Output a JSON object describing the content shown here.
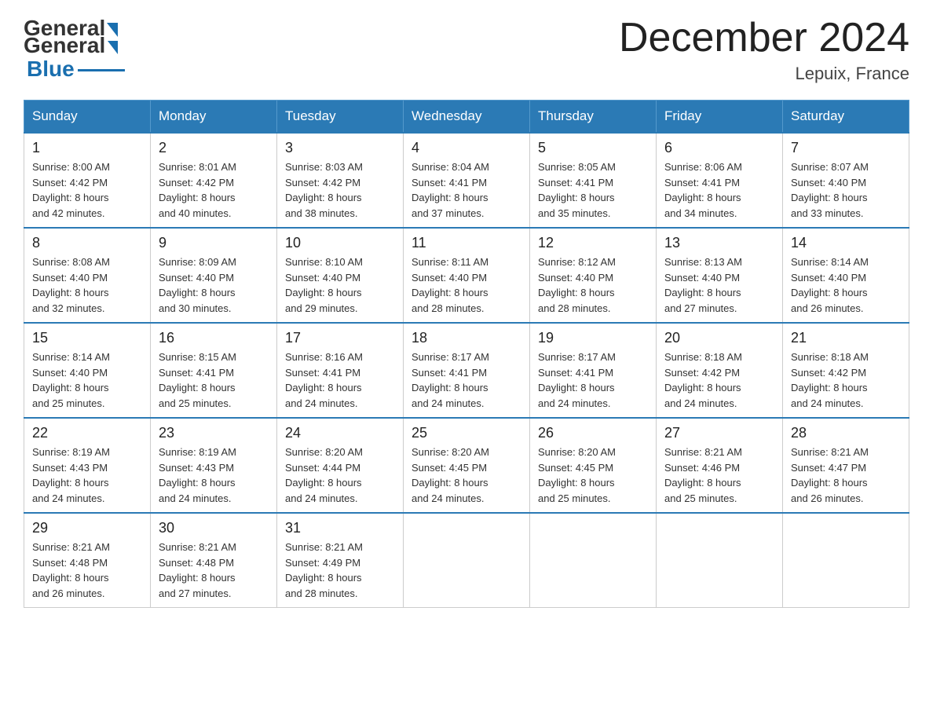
{
  "header": {
    "logo_general": "General",
    "logo_blue": "Blue",
    "month_title": "December 2024",
    "location": "Lepuix, France"
  },
  "days_of_week": [
    "Sunday",
    "Monday",
    "Tuesday",
    "Wednesday",
    "Thursday",
    "Friday",
    "Saturday"
  ],
  "weeks": [
    [
      {
        "day": "1",
        "sunrise": "8:00 AM",
        "sunset": "4:42 PM",
        "daylight": "8 hours and 42 minutes."
      },
      {
        "day": "2",
        "sunrise": "8:01 AM",
        "sunset": "4:42 PM",
        "daylight": "8 hours and 40 minutes."
      },
      {
        "day": "3",
        "sunrise": "8:03 AM",
        "sunset": "4:42 PM",
        "daylight": "8 hours and 38 minutes."
      },
      {
        "day": "4",
        "sunrise": "8:04 AM",
        "sunset": "4:41 PM",
        "daylight": "8 hours and 37 minutes."
      },
      {
        "day": "5",
        "sunrise": "8:05 AM",
        "sunset": "4:41 PM",
        "daylight": "8 hours and 35 minutes."
      },
      {
        "day": "6",
        "sunrise": "8:06 AM",
        "sunset": "4:41 PM",
        "daylight": "8 hours and 34 minutes."
      },
      {
        "day": "7",
        "sunrise": "8:07 AM",
        "sunset": "4:40 PM",
        "daylight": "8 hours and 33 minutes."
      }
    ],
    [
      {
        "day": "8",
        "sunrise": "8:08 AM",
        "sunset": "4:40 PM",
        "daylight": "8 hours and 32 minutes."
      },
      {
        "day": "9",
        "sunrise": "8:09 AM",
        "sunset": "4:40 PM",
        "daylight": "8 hours and 30 minutes."
      },
      {
        "day": "10",
        "sunrise": "8:10 AM",
        "sunset": "4:40 PM",
        "daylight": "8 hours and 29 minutes."
      },
      {
        "day": "11",
        "sunrise": "8:11 AM",
        "sunset": "4:40 PM",
        "daylight": "8 hours and 28 minutes."
      },
      {
        "day": "12",
        "sunrise": "8:12 AM",
        "sunset": "4:40 PM",
        "daylight": "8 hours and 28 minutes."
      },
      {
        "day": "13",
        "sunrise": "8:13 AM",
        "sunset": "4:40 PM",
        "daylight": "8 hours and 27 minutes."
      },
      {
        "day": "14",
        "sunrise": "8:14 AM",
        "sunset": "4:40 PM",
        "daylight": "8 hours and 26 minutes."
      }
    ],
    [
      {
        "day": "15",
        "sunrise": "8:14 AM",
        "sunset": "4:40 PM",
        "daylight": "8 hours and 25 minutes."
      },
      {
        "day": "16",
        "sunrise": "8:15 AM",
        "sunset": "4:41 PM",
        "daylight": "8 hours and 25 minutes."
      },
      {
        "day": "17",
        "sunrise": "8:16 AM",
        "sunset": "4:41 PM",
        "daylight": "8 hours and 24 minutes."
      },
      {
        "day": "18",
        "sunrise": "8:17 AM",
        "sunset": "4:41 PM",
        "daylight": "8 hours and 24 minutes."
      },
      {
        "day": "19",
        "sunrise": "8:17 AM",
        "sunset": "4:41 PM",
        "daylight": "8 hours and 24 minutes."
      },
      {
        "day": "20",
        "sunrise": "8:18 AM",
        "sunset": "4:42 PM",
        "daylight": "8 hours and 24 minutes."
      },
      {
        "day": "21",
        "sunrise": "8:18 AM",
        "sunset": "4:42 PM",
        "daylight": "8 hours and 24 minutes."
      }
    ],
    [
      {
        "day": "22",
        "sunrise": "8:19 AM",
        "sunset": "4:43 PM",
        "daylight": "8 hours and 24 minutes."
      },
      {
        "day": "23",
        "sunrise": "8:19 AM",
        "sunset": "4:43 PM",
        "daylight": "8 hours and 24 minutes."
      },
      {
        "day": "24",
        "sunrise": "8:20 AM",
        "sunset": "4:44 PM",
        "daylight": "8 hours and 24 minutes."
      },
      {
        "day": "25",
        "sunrise": "8:20 AM",
        "sunset": "4:45 PM",
        "daylight": "8 hours and 24 minutes."
      },
      {
        "day": "26",
        "sunrise": "8:20 AM",
        "sunset": "4:45 PM",
        "daylight": "8 hours and 25 minutes."
      },
      {
        "day": "27",
        "sunrise": "8:21 AM",
        "sunset": "4:46 PM",
        "daylight": "8 hours and 25 minutes."
      },
      {
        "day": "28",
        "sunrise": "8:21 AM",
        "sunset": "4:47 PM",
        "daylight": "8 hours and 26 minutes."
      }
    ],
    [
      {
        "day": "29",
        "sunrise": "8:21 AM",
        "sunset": "4:48 PM",
        "daylight": "8 hours and 26 minutes."
      },
      {
        "day": "30",
        "sunrise": "8:21 AM",
        "sunset": "4:48 PM",
        "daylight": "8 hours and 27 minutes."
      },
      {
        "day": "31",
        "sunrise": "8:21 AM",
        "sunset": "4:49 PM",
        "daylight": "8 hours and 28 minutes."
      },
      null,
      null,
      null,
      null
    ]
  ],
  "labels": {
    "sunrise": "Sunrise:",
    "sunset": "Sunset:",
    "daylight": "Daylight:"
  }
}
